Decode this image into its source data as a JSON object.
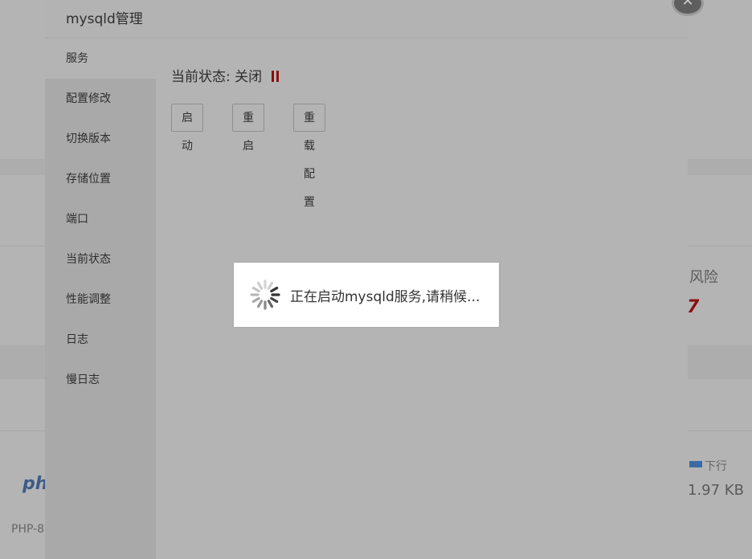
{
  "modal": {
    "title": "mysqld管理",
    "close_glyph": "✕",
    "sidebar": [
      {
        "label": "服务",
        "active": true
      },
      {
        "label": "配置修改"
      },
      {
        "label": "切换版本"
      },
      {
        "label": "存储位置"
      },
      {
        "label": "端口"
      },
      {
        "label": "当前状态"
      },
      {
        "label": "性能调整"
      },
      {
        "label": "日志"
      },
      {
        "label": "慢日志"
      }
    ],
    "status_label": "当前状态:",
    "status_value": "关闭",
    "status_icon": "pause-icon",
    "status_icon_color": "#8b0f0f",
    "buttons": {
      "start": "启动",
      "restart": "重启",
      "reload": "重载配置"
    }
  },
  "toast": {
    "message": "正在启动mysqld服务,请稍候..."
  },
  "background": {
    "risk_text": "风险",
    "risk_value": "7",
    "legend_down": "下行",
    "traffic_value": "1.97 KB",
    "php_label": "PHP-8",
    "logo_text": "ph"
  }
}
